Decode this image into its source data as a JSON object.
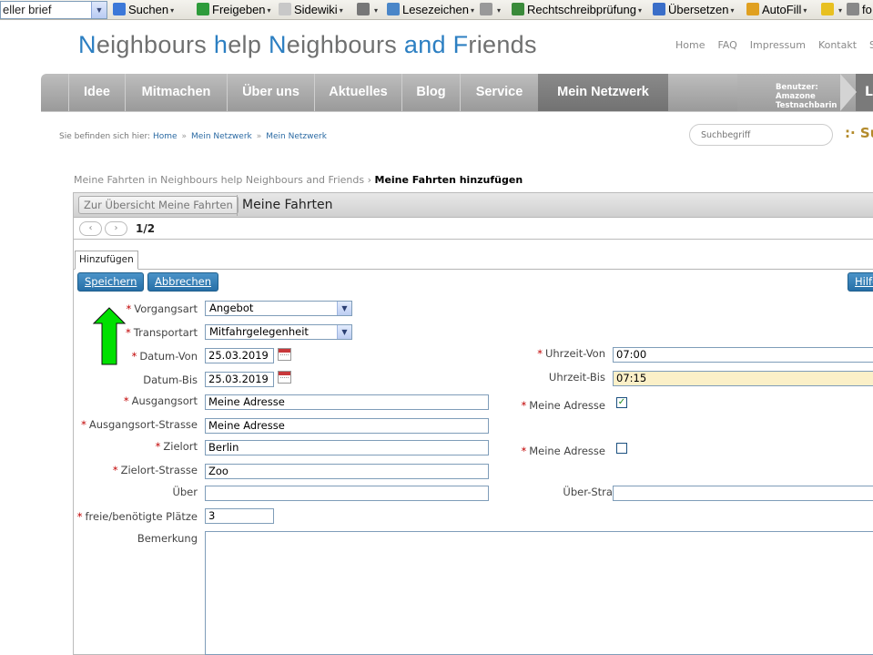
{
  "browser_toolbar": {
    "combo_value": "eller brief",
    "items": [
      {
        "label": "Suchen",
        "icon": "google-icon",
        "color": "#3c78d8"
      },
      {
        "label": "Freigeben",
        "icon": "share-icon",
        "color": "#2e9b3b"
      },
      {
        "label": "Sidewiki",
        "icon": "speech-bubble-icon",
        "color": "#c8c8c8"
      },
      {
        "label": "",
        "icon": "page-icon",
        "color": "#777777"
      },
      {
        "label": "Lesezeichen",
        "icon": "star-icon",
        "color": "#4a86c8"
      },
      {
        "label": "",
        "icon": "keyboard-icon",
        "color": "#999999"
      },
      {
        "label": "Rechtschreibprüfung",
        "icon": "spellcheck-icon",
        "color": "#3a8a3a"
      },
      {
        "label": "Übersetzen",
        "icon": "translate-icon",
        "color": "#3a6ec8"
      },
      {
        "label": "AutoFill",
        "icon": "autofill-icon",
        "color": "#e0a020"
      },
      {
        "label": "",
        "icon": "highlighter-icon",
        "color": "#e8c020"
      },
      {
        "label": "fo",
        "icon": "magnifier-icon",
        "color": "#888888"
      }
    ]
  },
  "site": {
    "title_parts": [
      {
        "text": "N",
        "blue": true
      },
      {
        "text": "eighbours ",
        "blue": false
      },
      {
        "text": "h",
        "blue": true
      },
      {
        "text": "elp ",
        "blue": false
      },
      {
        "text": "N",
        "blue": true
      },
      {
        "text": "eighbours ",
        "blue": false
      },
      {
        "text": "and ",
        "blue": true
      },
      {
        "text": "F",
        "blue": true
      },
      {
        "text": "riends",
        "blue": false
      }
    ],
    "top_links": [
      "Home",
      "FAQ",
      "Impressum",
      "Kontakt",
      "S"
    ]
  },
  "nav": {
    "items": [
      "Idee",
      "Mitmachen",
      "Über uns",
      "Aktuelles",
      "Blog",
      "Service",
      "Mein Netzwerk"
    ],
    "active": "Mein Netzwerk",
    "user_label": "Benutzer:",
    "user_name": "Amazone Testnachbarin",
    "user_last": "L"
  },
  "breadcrumb": {
    "prefix": "Sie befinden sich hier:",
    "items": [
      "Home",
      "Mein Netzwerk",
      "Mein Netzwerk"
    ]
  },
  "search": {
    "placeholder": "Suchbegriff",
    "go_label": ":· Su"
  },
  "page_crumb": {
    "parent": "Meine Fahrten in Neighbours help Neighbours and Friends",
    "separator": "›",
    "current": "Meine Fahrten hinzufügen"
  },
  "region": {
    "back_button": "Zur Übersicht Meine Fahrten",
    "title": "Meine Fahrten",
    "pager_prev": "‹",
    "pager_next": "›",
    "pager_text": "1/2",
    "tab_label": "Hinzufügen",
    "save_label": "Speichern",
    "cancel_label": "Abbrechen",
    "help_label": "Hilfe"
  },
  "form": {
    "vorgangsart": {
      "label": "Vorgangsart",
      "value": "Angebot"
    },
    "transportart": {
      "label": "Transportart",
      "value": "Mitfahrgelegenheit"
    },
    "datum_von": {
      "label": "Datum-Von",
      "value": "25.03.2019"
    },
    "datum_bis": {
      "label": "Datum-Bis",
      "value": "25.03.2019"
    },
    "uhrzeit_von": {
      "label": "Uhrzeit-Von",
      "value": "07:00"
    },
    "uhrzeit_bis": {
      "label": "Uhrzeit-Bis",
      "value": "07:15"
    },
    "ausgangsort": {
      "label": "Ausgangsort",
      "value": "Meine Adresse"
    },
    "ausgangsort_strasse": {
      "label": "Ausgangsort-Strasse",
      "value": "Meine Adresse"
    },
    "meine_adresse_1": {
      "label": "Meine Adresse",
      "checked": true
    },
    "zielort": {
      "label": "Zielort",
      "value": "Berlin"
    },
    "zielort_strasse": {
      "label": "Zielort-Strasse",
      "value": "Zoo"
    },
    "meine_adresse_2": {
      "label": "Meine Adresse",
      "checked": false
    },
    "ueber": {
      "label": "Über",
      "value": ""
    },
    "ueber_strasse": {
      "label": "Über-Strasse",
      "value": ""
    },
    "plaetze": {
      "label": "freie/benötigte Plätze",
      "value": "3"
    },
    "bemerkung": {
      "label": "Bemerkung",
      "value": ""
    },
    "required_marker": "*",
    "checkmark": "✓"
  },
  "colors": {
    "brand_blue": "#2c7fc2",
    "nav_gray": "#a8a8a8",
    "button_blue": "#2f78ae",
    "required_red": "#c10000",
    "arrow_green": "#00e000"
  }
}
